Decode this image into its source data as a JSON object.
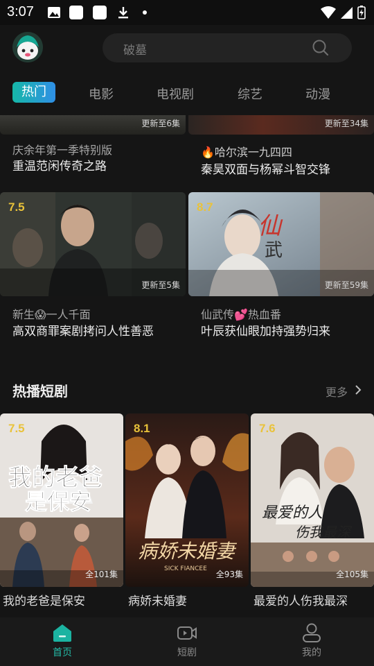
{
  "status_bar": {
    "time": "3:07"
  },
  "header": {
    "search_placeholder": "破墓"
  },
  "tabs": [
    {
      "label": "热门",
      "active": true
    },
    {
      "label": "电影"
    },
    {
      "label": "电视剧"
    },
    {
      "label": "综艺"
    },
    {
      "label": "动漫"
    }
  ],
  "top_cards": [
    {
      "update": "更新至6集",
      "line1": "庆余年第一季特别版",
      "line2": "重温范闲传奇之路"
    },
    {
      "update": "更新至34集",
      "line1": "🔥哈尔滨一九四四",
      "line2": "秦昊双面与杨幂斗智交锋"
    }
  ],
  "cards": [
    {
      "score": "7.5",
      "update": "更新至5集",
      "line1": "新生😱一人千面",
      "line2": "高双商罪案剧拷问人性善恶"
    },
    {
      "score": "8.7",
      "update": "更新至59集",
      "line1": "仙武传💕热血番",
      "line2": "叶辰获仙眼加持强势归来"
    }
  ],
  "short_drama": {
    "title": "热播短剧",
    "more": "更多",
    "items": [
      {
        "score": "7.5",
        "count": "全101集",
        "name": "我的老爸是保安"
      },
      {
        "score": "8.1",
        "count": "全93集",
        "name": "病娇未婚妻"
      },
      {
        "score": "7.6",
        "count": "全105集",
        "name": "最爱的人伤我最深"
      }
    ]
  },
  "bottom_nav": [
    {
      "label": "首页",
      "icon": "home-icon",
      "active": true
    },
    {
      "label": "短剧",
      "icon": "video-icon"
    },
    {
      "label": "我的",
      "icon": "profile-icon"
    }
  ],
  "colors": {
    "accent": "#24b9a6",
    "score": "#e9c23a",
    "background": "#151515"
  }
}
